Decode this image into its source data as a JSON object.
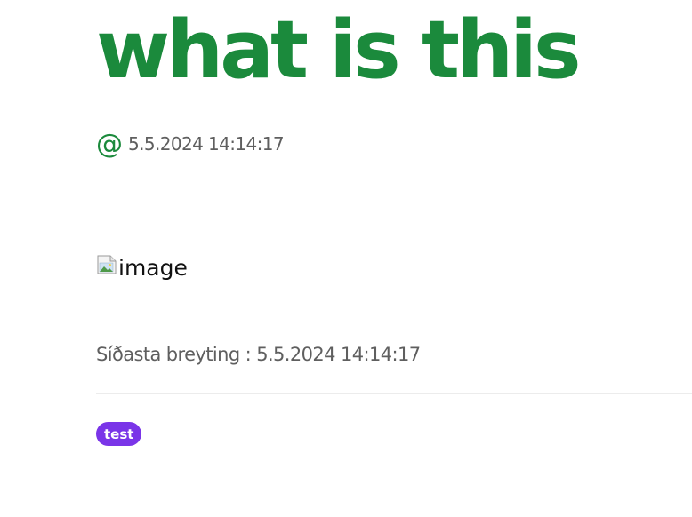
{
  "post": {
    "title": "what is this",
    "at_symbol": "@",
    "published": "5.5.2024 14:14:17",
    "image_alt": "image",
    "modified_label": "Síðasta breyting :",
    "modified": "5.5.2024 14:14:17"
  },
  "tags": [
    {
      "label": "test"
    }
  ],
  "colors": {
    "title": "#1b8a3c",
    "meta_text": "#5f5f5f",
    "tag_background": "#7a35e8",
    "divider": "#ececec"
  },
  "icons": {
    "author": "at-sign-icon",
    "image_placeholder": "broken-image-icon"
  }
}
